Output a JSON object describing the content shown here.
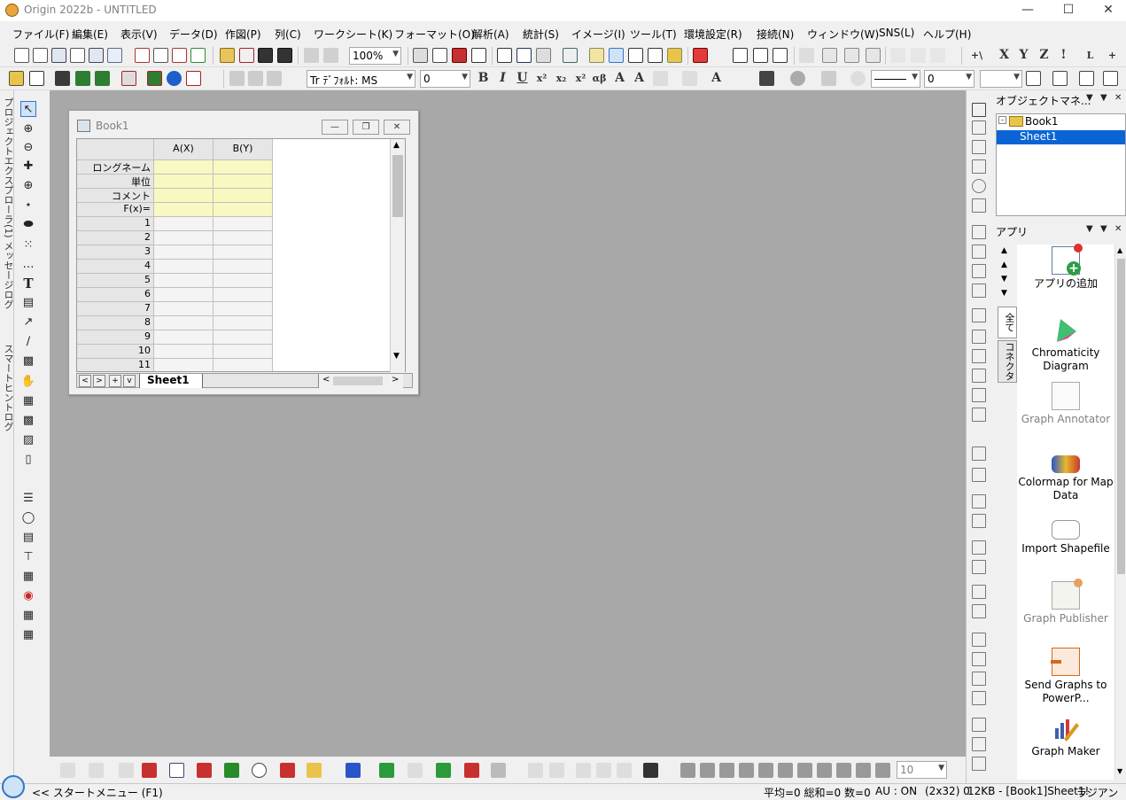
{
  "window": {
    "title": "Origin 2022b - UNTITLED"
  },
  "menu": [
    "ファイル(F)",
    "編集(E)",
    "表示(V)",
    "データ(D)",
    "作図(P)",
    "列(C)",
    "ワークシート(K)",
    "フォーマット(O)",
    "解析(A)",
    "統計(S)",
    "イメージ(I)",
    "ツール(T)",
    "環境設定(R)",
    "接続(N)",
    "ウィンドウ(W)",
    "SNS(L)",
    "ヘルプ(H)"
  ],
  "toolbar": {
    "zoom": "100%",
    "font": "Tr ﾃﾞﾌｫﾙﾄ: MS",
    "fontsize": "0",
    "linewidth": "0",
    "bottom_zoom": "10"
  },
  "left_tabs": [
    "プロジェクトエクスプローラ(1)",
    "メッセージログ",
    "スマートヒントログ"
  ],
  "book": {
    "title": "Book1",
    "columns": [
      "A(X)",
      "B(Y)"
    ],
    "label_rows": [
      "ロングネーム",
      "単位",
      "コメント",
      "F(x)="
    ],
    "rows": [
      "1",
      "2",
      "3",
      "4",
      "5",
      "6",
      "7",
      "8",
      "9",
      "10",
      "11"
    ],
    "sheet_tab": "Sheet1"
  },
  "object_manager": {
    "title": "オブジェクトマネ...",
    "items": [
      {
        "label": "Book1",
        "level": 0,
        "selected": false
      },
      {
        "label": "Sheet1",
        "level": 1,
        "selected": true
      }
    ]
  },
  "apps_panel": {
    "title": "アプリ",
    "side_tabs": [
      "全て",
      "コネクタ"
    ],
    "items": [
      {
        "name": "アプリの追加",
        "active": true
      },
      {
        "name": "Chromaticity Diagram",
        "active": true
      },
      {
        "name": "Graph Annotator",
        "active": false
      },
      {
        "name": "Colormap for Map Data",
        "active": true
      },
      {
        "name": "Import Shapefile",
        "active": true
      },
      {
        "name": "Graph Publisher",
        "active": false
      },
      {
        "name": "Send Graphs to PowerP...",
        "active": true
      },
      {
        "name": "Graph Maker",
        "active": true
      }
    ]
  },
  "status": {
    "start": "<< スタートメニュー (F1)",
    "stats": "平均=0 総和=0 数=0",
    "au": "AU : ON",
    "dims": "(2x32) 0",
    "info": "12KB - [Book1]Sheet1!",
    "unit": "ラジアン"
  },
  "colors": {
    "selection": "#0a64d6",
    "label_row_fill": "#f8f8c2",
    "workspace": "#a8a8a8"
  }
}
